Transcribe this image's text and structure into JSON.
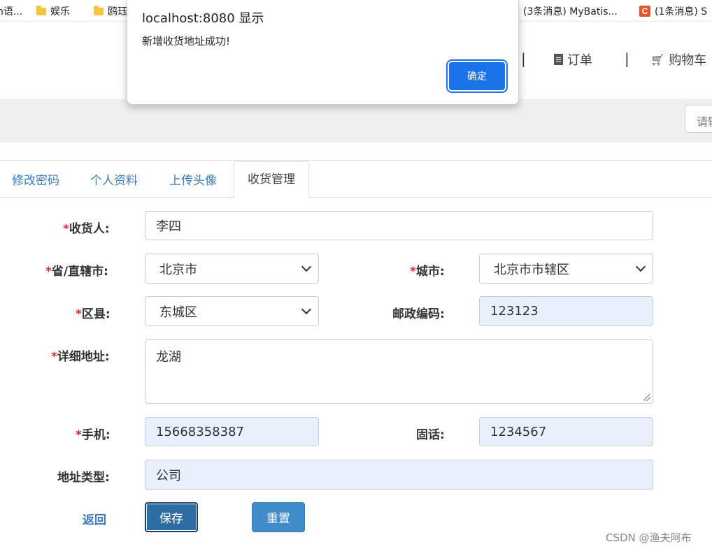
{
  "bookmarks": [
    {
      "label": "n语...",
      "icon": "none"
    },
    {
      "label": "娱乐",
      "icon": "folder-icon"
    },
    {
      "label": "鸥珏",
      "icon": "folder-icon"
    },
    {
      "label": "(3条消息) MyBatis...",
      "icon": "csdn-icon"
    },
    {
      "label": "(1条消息) S",
      "icon": "csdn-icon",
      "icon_text": "C"
    }
  ],
  "header": {
    "orders_label": "订单",
    "cart_label": "购物车",
    "search_placeholder": "请输"
  },
  "tabs": [
    {
      "label": "修改密码"
    },
    {
      "label": "个人资料"
    },
    {
      "label": "上传头像"
    },
    {
      "label": "收货管理",
      "active": true
    }
  ],
  "form": {
    "required_mark": "*",
    "receiver_label": "收货人:",
    "receiver_value": "李四",
    "province_label": "省/直辖市:",
    "province_value": "北京市",
    "city_label": "城市:",
    "city_value": "北京市市辖区",
    "district_label": "区县:",
    "district_value": "东城区",
    "zip_label": "邮政编码:",
    "zip_value": "123123",
    "address_label": "详细地址:",
    "address_value": "龙湖",
    "phone_label": "手机:",
    "phone_value": "15668358387",
    "tel_label": "固话:",
    "tel_value": "1234567",
    "type_label": "地址类型:",
    "type_value": "公司",
    "back_label": "返回",
    "save_label": "保存",
    "reset_label": "重置"
  },
  "dialog": {
    "title": "localhost:8080 显示",
    "message": "新增收货地址成功!",
    "ok_label": "确定"
  },
  "watermark": "CSDN @渔夫阿布",
  "colors": {
    "link": "#3a7bbf",
    "primary_button": "#428bca",
    "dialog_button": "#1a73e8",
    "required": "#d32f2f",
    "autofill": "#e8f0fe"
  }
}
